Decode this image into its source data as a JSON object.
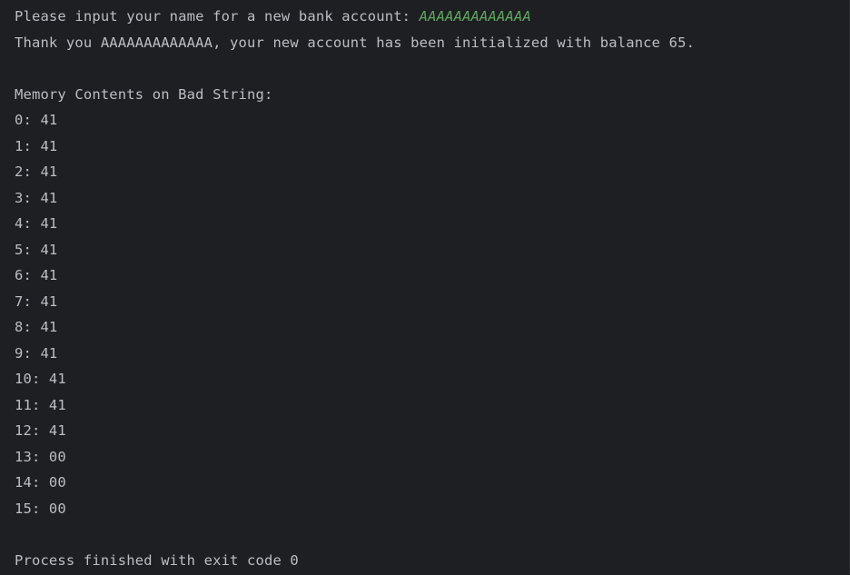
{
  "console": {
    "prompt_text": "Please input your name for a new bank account: ",
    "prompt_input": "AAAAAAAAAAAAA",
    "thanks_line": "Thank you AAAAAAAAAAAAA, your new account has been initialized with balance 65.",
    "memory_header": "Memory Contents on Bad String:",
    "memory_lines": [
      "0: 41",
      "1: 41",
      "2: 41",
      "3: 41",
      "4: 41",
      "5: 41",
      "6: 41",
      "7: 41",
      "8: 41",
      "9: 41",
      "10: 41",
      "11: 41",
      "12: 41",
      "13: 00",
      "14: 00",
      "15: 00"
    ],
    "exit_line": "Process finished with exit code 0"
  },
  "colors": {
    "background": "#1e1f22",
    "text": "#bcbec4",
    "user_input": "#5fa85f"
  }
}
